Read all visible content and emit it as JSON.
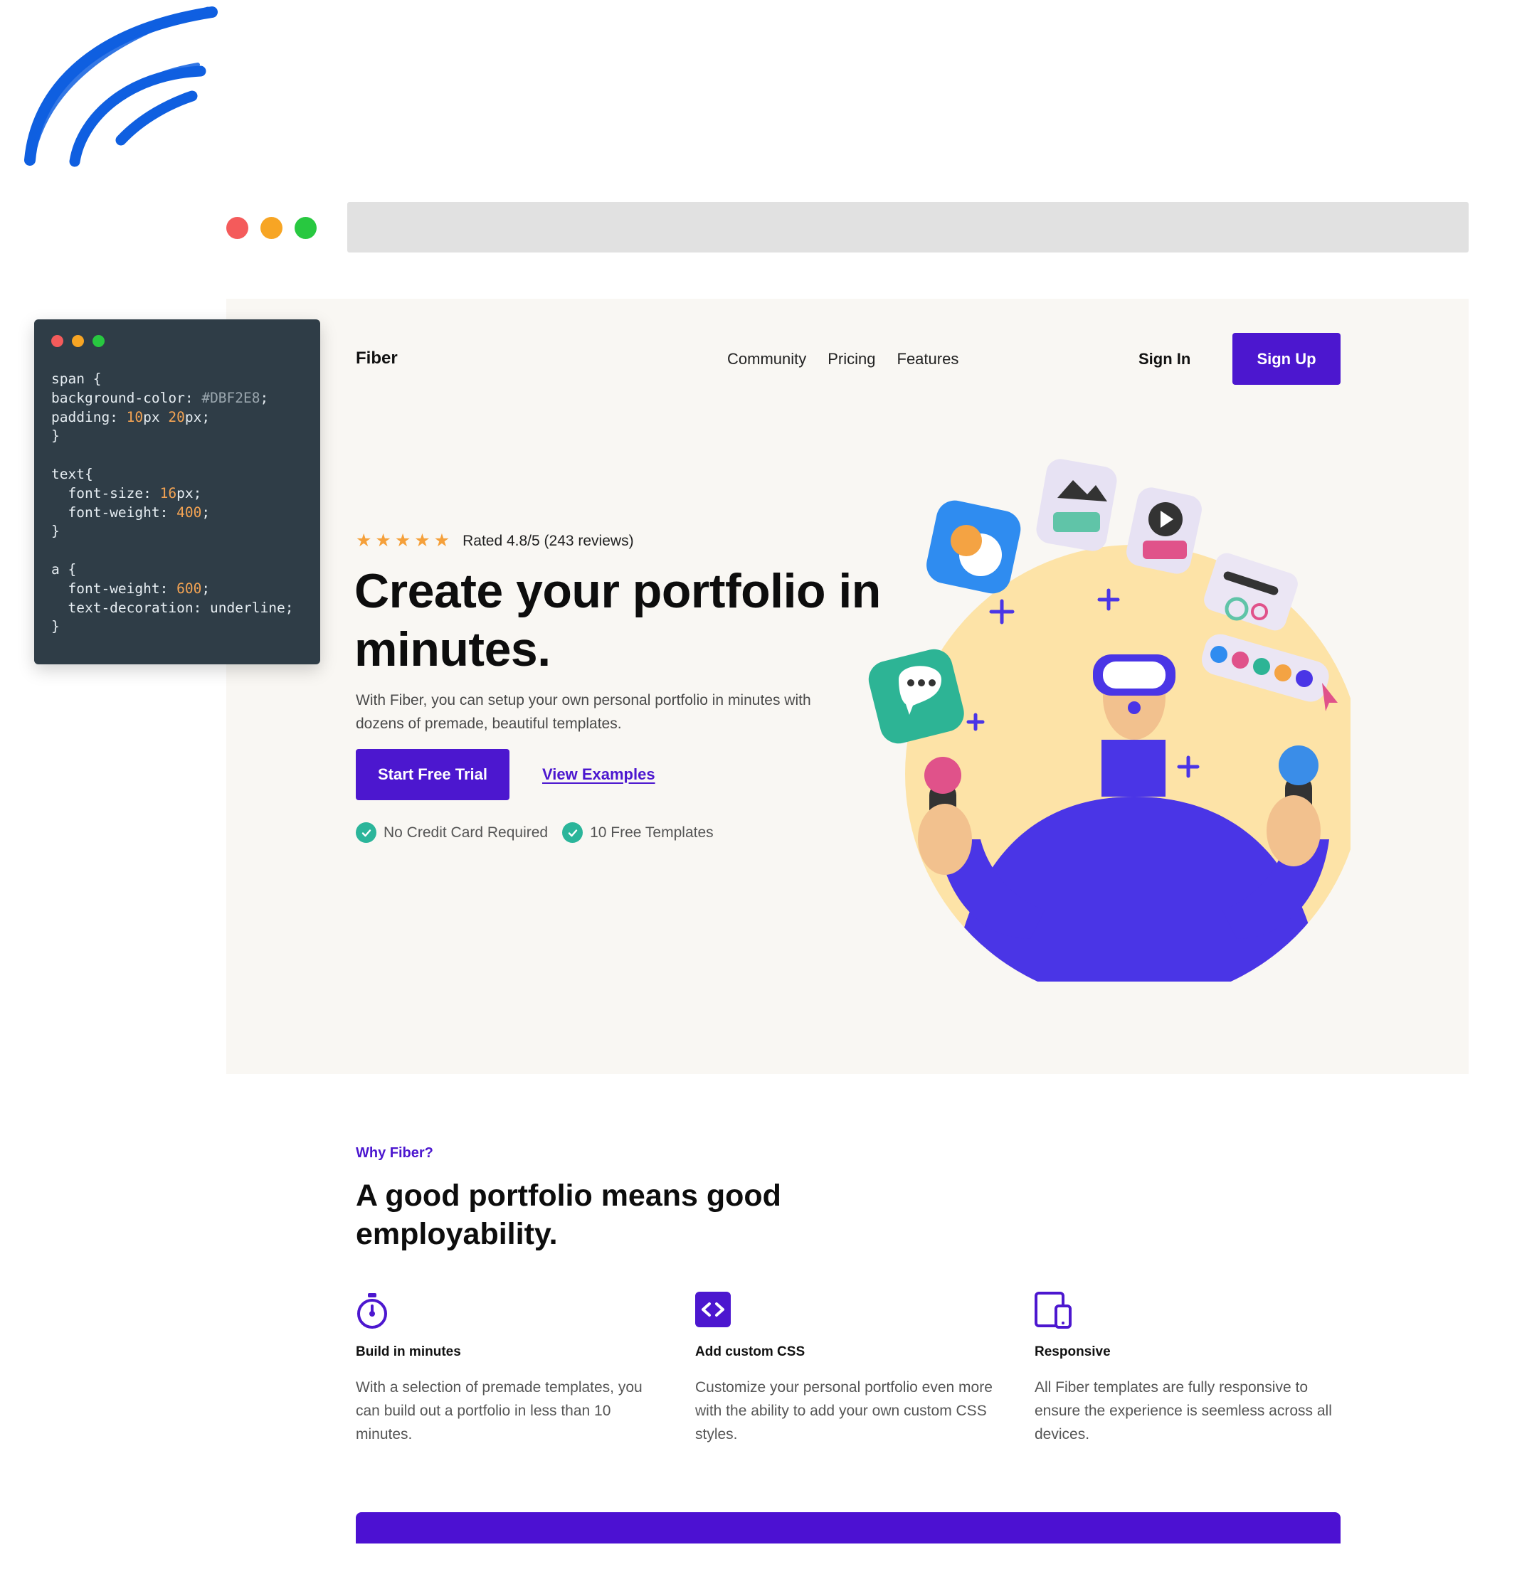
{
  "colors": {
    "accent": "#4c17cf",
    "hero_bg": "#f9f7f3",
    "check": "#2bb59a",
    "star": "#f5a03a",
    "brush": "#0f5fe0",
    "dot_red": "#f45b5b",
    "dot_yellow": "#f7a524",
    "dot_green": "#28c840"
  },
  "browser": {
    "dots": [
      "red-dot",
      "yellow-dot",
      "green-dot"
    ],
    "address_bar_text": ""
  },
  "site": {
    "logo": "Fiber",
    "nav": [
      "Community",
      "Pricing",
      "Features"
    ],
    "sign_in": "Sign In",
    "sign_up": "Sign Up"
  },
  "hero": {
    "rating_stars": 5,
    "rating_text": "Rated 4.8/5 (243 reviews)",
    "headline": "Create your portfolio in minutes.",
    "subtext": "With Fiber, you can setup your own personal portfolio in minutes with dozens of premade, beautiful templates.",
    "cta_primary": "Start Free Trial",
    "cta_secondary": "View Examples",
    "checks": [
      "No Credit Card Required",
      "10 Free Templates"
    ]
  },
  "why": {
    "eyebrow": "Why Fiber?",
    "title": "A good portfolio means good employability.",
    "features": [
      {
        "icon": "stopwatch-icon",
        "title": "Build in minutes",
        "text": "With a selection of premade templates, you can build out a portfolio in less than 10 minutes."
      },
      {
        "icon": "code-icon",
        "title": "Add custom CSS",
        "text": "Customize your personal portfolio even more with the ability to add your own custom CSS styles."
      },
      {
        "icon": "devices-icon",
        "title": "Responsive",
        "text": "All Fiber templates are fully responsive to ensure the experience is seemless across all devices."
      }
    ]
  },
  "code_panel": {
    "lines": [
      "span {",
      "background-color: #DBF2E8;",
      "padding: 10px 20px;",
      "}",
      "",
      "text{",
      "  font-size: 16px;",
      "  font-weight: 400;",
      "}",
      "",
      "a {",
      "  font-weight: 600;",
      "  text-decoration: underline;",
      "}"
    ]
  }
}
